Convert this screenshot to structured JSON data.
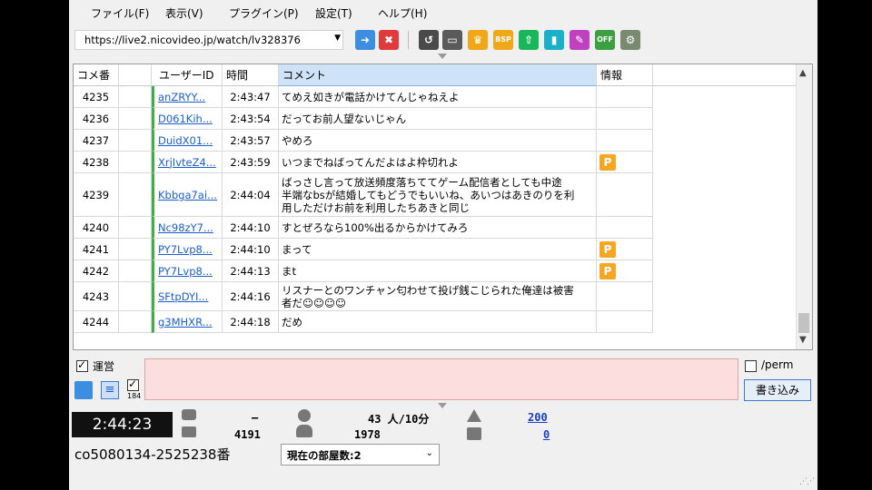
{
  "menu": [
    "ファイル(F)",
    "表示(V)",
    "プラグイン(P)",
    "設定(T)",
    "ヘルプ(H)"
  ],
  "url": "https://live2.nicovideo.jp/watch/lv328376",
  "toolbar_icons": [
    "connect-icon",
    "disconnect-icon",
    "undo-icon",
    "window-icon",
    "crown-icon",
    "bsp-icon",
    "upload-icon",
    "stats-icon",
    "tag-icon",
    "off-icon",
    "settings-icon"
  ],
  "grid": {
    "headers": {
      "no": "コメ番",
      "user": "ユーザーID",
      "time": "時間",
      "comment": "コメント",
      "info": "情報"
    },
    "rows": [
      {
        "no": "4235",
        "user": "anZRYY...",
        "time": "2:43:47",
        "comment": [
          "てめえ如きが電話かけてんじゃねえよ"
        ],
        "badge": ""
      },
      {
        "no": "4236",
        "user": "D061Kih...",
        "time": "2:43:54",
        "comment": [
          "だってお前人望ないじゃん"
        ],
        "badge": ""
      },
      {
        "no": "4237",
        "user": "DuidX01...",
        "time": "2:43:57",
        "comment": [
          "やめろ"
        ],
        "badge": ""
      },
      {
        "no": "4238",
        "user": "XrjIvteZ4...",
        "time": "2:43:59",
        "comment": [
          "いつまでねばってんだよはよ枠切れよ"
        ],
        "badge": "P"
      },
      {
        "no": "4239",
        "user": "Kbbga7ai...",
        "time": "2:44:04",
        "comment": [
          "ばっさし言って放送頻度落ちててゲーム配信者としても中途",
          "半端なbsが結婚してもどうでもいいね、あいつはあきのりを利",
          "用しただけお前を利用したちあきと同じ"
        ],
        "badge": ""
      },
      {
        "no": "4240",
        "user": "Nc98zY7...",
        "time": "2:44:10",
        "comment": [
          "すとぜろなら100%出るからかけてみろ"
        ],
        "badge": ""
      },
      {
        "no": "4241",
        "user": "PY7Lvp8...",
        "time": "2:44:10",
        "comment": [
          "まって"
        ],
        "badge": "P"
      },
      {
        "no": "4242",
        "user": "PY7Lvp8...",
        "time": "2:44:13",
        "comment": [
          "まt"
        ],
        "badge": "P"
      },
      {
        "no": "4243",
        "user": "SFtpDYI...",
        "time": "2:44:16",
        "comment": [
          "リスナーとのワンチャン匂わせて投げ銭こじられた俺達は被害",
          "者だ☺☺☺☺"
        ],
        "badge": ""
      },
      {
        "no": "4244",
        "user": "g3MHXR...",
        "time": "2:44:18",
        "comment": [
          "だめ"
        ],
        "badge": ""
      }
    ]
  },
  "bottom": {
    "unei_label": "運営",
    "perm_label": "/perm",
    "write_label": "書き込み",
    "hide_label": "184",
    "clock": "2:44:23",
    "comment_dash": "—",
    "comment_count": "4191",
    "visitors_rate": "43 人/10分",
    "visitors_total": "1978",
    "ad_points": "200",
    "gift_points": "0",
    "community_id": "co5080134-2525238番",
    "room_select": "現在の部屋数:2"
  },
  "colors": {
    "accent_blue": "#3a7bd5",
    "input_bg": "#fcdede",
    "badge_orange": "#f5a623",
    "uid_green_bar": "#3cb043"
  }
}
